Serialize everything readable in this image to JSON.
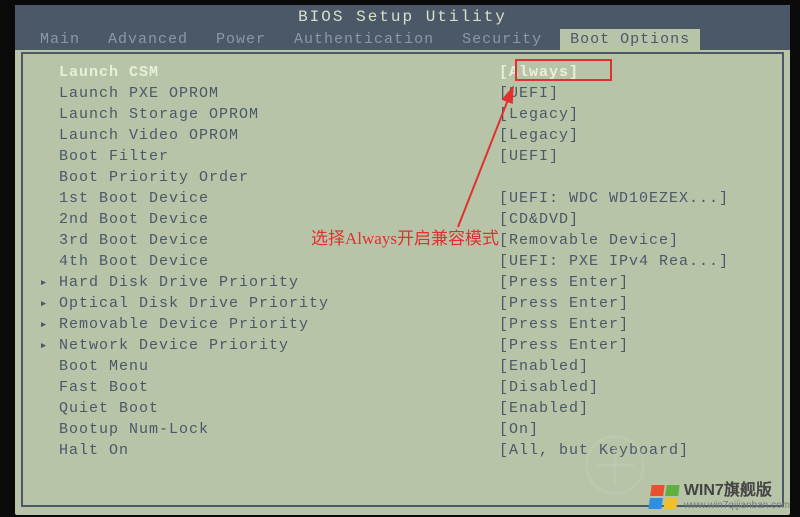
{
  "title": "BIOS Setup Utility",
  "tabs": [
    {
      "label": "Main",
      "active": false
    },
    {
      "label": "Advanced",
      "active": false
    },
    {
      "label": "Power",
      "active": false
    },
    {
      "label": "Authentication",
      "active": false
    },
    {
      "label": "Security",
      "active": false
    },
    {
      "label": "Boot Options",
      "active": true
    }
  ],
  "rows": [
    {
      "label": "Launch CSM",
      "value": "[Always]",
      "selected": true,
      "arrow": false
    },
    {
      "label": "Launch PXE OPROM",
      "value": "[UEFI]",
      "selected": false,
      "arrow": false
    },
    {
      "label": "Launch Storage OPROM",
      "value": "[Legacy]",
      "selected": false,
      "arrow": false
    },
    {
      "label": "Launch Video OPROM",
      "value": "[Legacy]",
      "selected": false,
      "arrow": false
    },
    {
      "label": "Boot Filter",
      "value": "[UEFI]",
      "selected": false,
      "arrow": false
    },
    {
      "label": "Boot Priority Order",
      "value": "",
      "selected": false,
      "arrow": false
    },
    {
      "label": "1st Boot Device",
      "value": "[UEFI: WDC WD10EZEX...]",
      "selected": false,
      "arrow": false
    },
    {
      "label": "2nd Boot Device",
      "value": "[CD&DVD]",
      "selected": false,
      "arrow": false
    },
    {
      "label": "3rd Boot Device",
      "value": "[Removable Device]",
      "selected": false,
      "arrow": false
    },
    {
      "label": "4th Boot Device",
      "value": "[UEFI: PXE IPv4 Rea...]",
      "selected": false,
      "arrow": false
    },
    {
      "label": "Hard Disk Drive Priority",
      "value": "[Press Enter]",
      "selected": false,
      "arrow": true
    },
    {
      "label": "Optical Disk Drive Priority",
      "value": "[Press Enter]",
      "selected": false,
      "arrow": true
    },
    {
      "label": "Removable Device Priority",
      "value": "[Press Enter]",
      "selected": false,
      "arrow": true
    },
    {
      "label": "Network Device Priority",
      "value": "[Press Enter]",
      "selected": false,
      "arrow": true
    },
    {
      "label": "Boot Menu",
      "value": "[Enabled]",
      "selected": false,
      "arrow": false
    },
    {
      "label": "Fast Boot",
      "value": "[Disabled]",
      "selected": false,
      "arrow": false
    },
    {
      "label": "Quiet Boot",
      "value": "[Enabled]",
      "selected": false,
      "arrow": false
    },
    {
      "label": "Bootup Num-Lock",
      "value": "[On]",
      "selected": false,
      "arrow": false
    },
    {
      "label": "Halt On",
      "value": "[All, but Keyboard]",
      "selected": false,
      "arrow": false
    }
  ],
  "annotation": {
    "text": "选择Always开启兼容模式"
  },
  "watermark": {
    "main": "WIN7旗舰版",
    "sub": "www.win7qijianban.com"
  },
  "arrow_glyph": "▸"
}
